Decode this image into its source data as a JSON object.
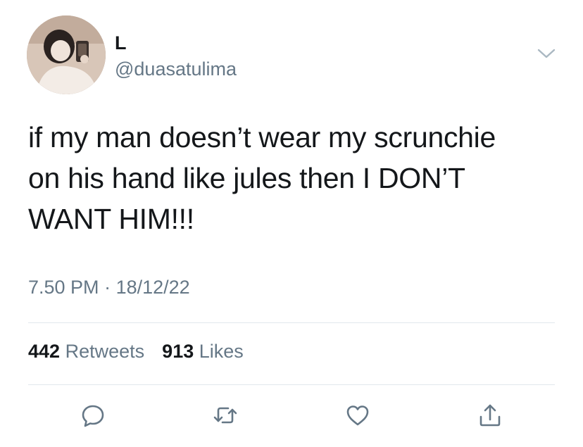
{
  "author": {
    "display_name": "L",
    "handle": "@duasatulima"
  },
  "tweet": {
    "text_lines": [
      "if my man doesn’t wear my scrunchie",
      "on his hand like jules then I DON’T",
      "WANT HIM!!!"
    ],
    "time": "7.50 PM",
    "separator": "·",
    "date": "18/12/22"
  },
  "stats": {
    "retweets_count": "442",
    "retweets_label": "Retweets",
    "likes_count": "913",
    "likes_label": "Likes"
  },
  "actions": {
    "icons": [
      "reply-icon",
      "retweet-icon",
      "like-icon",
      "share-icon"
    ]
  },
  "colors": {
    "text": "#14171a",
    "secondary": "#657786",
    "divider": "#e1e8ed"
  }
}
